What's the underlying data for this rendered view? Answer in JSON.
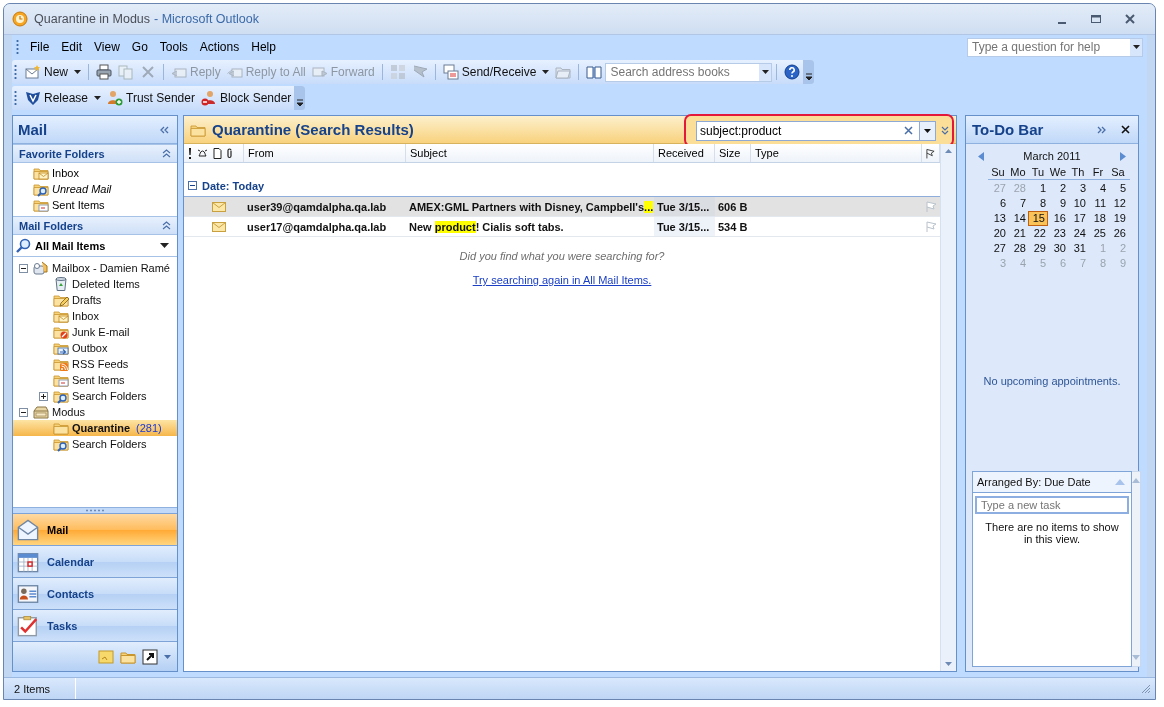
{
  "window": {
    "title": "Quarantine in Modus",
    "app_name": "- Microsoft Outlook"
  },
  "menu": [
    "File",
    "Edit",
    "View",
    "Go",
    "Tools",
    "Actions",
    "Help"
  ],
  "help_box": {
    "placeholder": "Type a question for help"
  },
  "toolbar": [
    {
      "kind": "new",
      "label": "New",
      "disabled": false,
      "dropdown": true
    },
    {
      "kind": "separator"
    },
    {
      "kind": "print",
      "disabled": false
    },
    {
      "kind": "move",
      "disabled": true
    },
    {
      "kind": "delete",
      "disabled": true
    },
    {
      "kind": "separator"
    },
    {
      "kind": "reply",
      "label": "Reply",
      "disabled": true
    },
    {
      "kind": "reply_all",
      "label": "Reply to All",
      "disabled": true
    },
    {
      "kind": "forward",
      "label": "Forward",
      "disabled": true
    },
    {
      "kind": "separator"
    },
    {
      "kind": "categorize",
      "disabled": true
    },
    {
      "kind": "flag",
      "disabled": true
    },
    {
      "kind": "separator"
    },
    {
      "kind": "send_receive",
      "label": "Send/Receive",
      "disabled": false,
      "dropdown": true
    },
    {
      "kind": "folder",
      "disabled": true
    },
    {
      "kind": "separator"
    },
    {
      "kind": "address_book",
      "disabled": false
    },
    {
      "kind": "search",
      "placeholder": "Search address books"
    },
    {
      "kind": "separator"
    },
    {
      "kind": "help",
      "disabled": false
    }
  ],
  "toolbar_2": [
    {
      "kind": "release",
      "label": "Release",
      "dropdown": true
    },
    {
      "kind": "trust",
      "label": "Trust Sender",
      "dropdown": false
    },
    {
      "kind": "block",
      "label": "Block Sender",
      "dropdown": false
    }
  ],
  "navigation": {
    "title": "Mail",
    "favorites": {
      "title": "Favorite Folders",
      "items": [
        {
          "kind": "inbox",
          "label": "Inbox",
          "italic": false
        },
        {
          "kind": "search",
          "label": "Unread Mail",
          "italic": true
        },
        {
          "kind": "sent",
          "label": "Sent Items",
          "italic": false
        }
      ]
    },
    "folders_title": "Mail Folders",
    "view": "All Mail Items",
    "tree": [
      {
        "kind": "mailbox",
        "label": "Mailbox - Damien Ramé",
        "expanded": true,
        "selected": false,
        "children": [
          {
            "kind": "trash",
            "label": "Deleted Items",
            "selected": false
          },
          {
            "kind": "drafts",
            "label": "Drafts",
            "selected": false
          },
          {
            "kind": "inbox",
            "label": "Inbox",
            "selected": false
          },
          {
            "kind": "junk",
            "label": "Junk E-mail",
            "selected": false
          },
          {
            "kind": "outbox",
            "label": "Outbox",
            "selected": false
          },
          {
            "kind": "rss",
            "label": "RSS Feeds",
            "selected": false
          },
          {
            "kind": "sent",
            "label": "Sent Items",
            "selected": false
          },
          {
            "kind": "search",
            "label": "Search Folders",
            "expanded": false,
            "selected": false
          }
        ]
      },
      {
        "kind": "archive",
        "label": "Modus",
        "expanded": true,
        "selected": false,
        "children": [
          {
            "kind": "folder",
            "label": "Quarantine",
            "count": "(281)",
            "selected": true
          },
          {
            "kind": "search",
            "label": "Search Folders",
            "selected": false
          }
        ]
      }
    ],
    "buttons": [
      {
        "kind": "mail",
        "label": "Mail",
        "selected": true
      },
      {
        "kind": "calendar",
        "label": "Calendar",
        "selected": false
      },
      {
        "kind": "contacts",
        "label": "Contacts",
        "selected": false
      },
      {
        "kind": "tasks",
        "label": "Tasks",
        "selected": false
      }
    ]
  },
  "list": {
    "title": "Quarantine (Search Results)",
    "search": {
      "value": "subject:product"
    },
    "columns": [
      "From",
      "Subject",
      "Received",
      "Size",
      "Type"
    ],
    "group": "Date: Today",
    "rows": [
      {
        "from": "user39@qamdalpha.qa.lab",
        "subject": [
          {
            "text": "AMEX:GML Partners with Disney, Campbell's",
            "highlight": false
          },
          {
            "text": "...",
            "highlight": true
          }
        ],
        "received": "Tue 3/15...",
        "size": "606 B",
        "selected": true
      },
      {
        "from": "user17@qamdalpha.qa.lab",
        "subject": [
          {
            "text": "New ",
            "highlight": false
          },
          {
            "text": "product",
            "highlight": true
          },
          {
            "text": "! Cialis soft tabs.",
            "highlight": false
          }
        ],
        "received": "Tue 3/15...",
        "size": "534 B",
        "selected": false
      }
    ],
    "question": "Did you find what you were searching for?",
    "link": "Try searching again in All Mail Items."
  },
  "todo": {
    "title": "To-Do Bar",
    "month": "March 2011",
    "weekdays": [
      "Su",
      "Mo",
      "Tu",
      "We",
      "Th",
      "Fr",
      "Sa"
    ],
    "weeks": [
      [
        {
          "d": "27",
          "muted": true,
          "selected": false
        },
        {
          "d": "28",
          "muted": true,
          "selected": false
        },
        {
          "d": "1",
          "muted": false,
          "selected": false
        },
        {
          "d": "2",
          "muted": false,
          "selected": false
        },
        {
          "d": "3",
          "muted": false,
          "selected": false
        },
        {
          "d": "4",
          "muted": false,
          "selected": false
        },
        {
          "d": "5",
          "muted": false,
          "selected": false
        }
      ],
      [
        {
          "d": "6",
          "muted": false,
          "selected": false
        },
        {
          "d": "7",
          "muted": false,
          "selected": false
        },
        {
          "d": "8",
          "muted": false,
          "selected": false
        },
        {
          "d": "9",
          "muted": false,
          "selected": false
        },
        {
          "d": "10",
          "muted": false,
          "selected": false
        },
        {
          "d": "11",
          "muted": false,
          "selected": false
        },
        {
          "d": "12",
          "muted": false,
          "selected": false
        }
      ],
      [
        {
          "d": "13",
          "muted": false,
          "selected": false
        },
        {
          "d": "14",
          "muted": false,
          "selected": false
        },
        {
          "d": "15",
          "muted": false,
          "selected": true
        },
        {
          "d": "16",
          "muted": false,
          "selected": false
        },
        {
          "d": "17",
          "muted": false,
          "selected": false
        },
        {
          "d": "18",
          "muted": false,
          "selected": false
        },
        {
          "d": "19",
          "muted": false,
          "selected": false
        }
      ],
      [
        {
          "d": "20",
          "muted": false,
          "selected": false
        },
        {
          "d": "21",
          "muted": false,
          "selected": false
        },
        {
          "d": "22",
          "muted": false,
          "selected": false
        },
        {
          "d": "23",
          "muted": false,
          "selected": false
        },
        {
          "d": "24",
          "muted": false,
          "selected": false
        },
        {
          "d": "25",
          "muted": false,
          "selected": false
        },
        {
          "d": "26",
          "muted": false,
          "selected": false
        }
      ],
      [
        {
          "d": "27",
          "muted": false,
          "selected": false
        },
        {
          "d": "28",
          "muted": false,
          "selected": false
        },
        {
          "d": "29",
          "muted": false,
          "selected": false
        },
        {
          "d": "30",
          "muted": false,
          "selected": false
        },
        {
          "d": "31",
          "muted": false,
          "selected": false
        },
        {
          "d": "1",
          "muted": true,
          "selected": false
        },
        {
          "d": "2",
          "muted": true,
          "selected": false
        }
      ],
      [
        {
          "d": "3",
          "muted": true,
          "selected": false
        },
        {
          "d": "4",
          "muted": true,
          "selected": false
        },
        {
          "d": "5",
          "muted": true,
          "selected": false
        },
        {
          "d": "6",
          "muted": true,
          "selected": false
        },
        {
          "d": "7",
          "muted": true,
          "selected": false
        },
        {
          "d": "8",
          "muted": true,
          "selected": false
        },
        {
          "d": "9",
          "muted": true,
          "selected": false
        }
      ]
    ],
    "appointments": "No upcoming appointments.",
    "tasks": {
      "arranged_by": "Arranged By: Due Date",
      "placeholder": "Type a new task",
      "empty": "There are no items to show in this view."
    }
  },
  "status_bar": {
    "text": "2 Items"
  }
}
